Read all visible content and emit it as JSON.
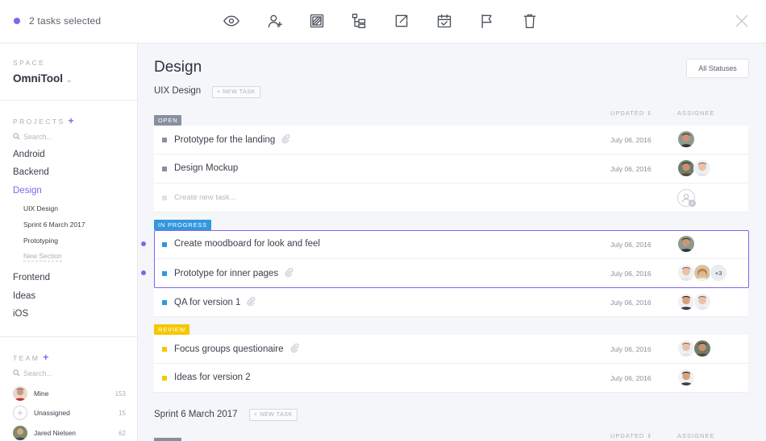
{
  "topbar": {
    "selection_text": "2 tasks selected",
    "icons": [
      "eye-icon",
      "add-assignee-icon",
      "tag-icon",
      "subtask-icon",
      "move-icon",
      "due-date-icon",
      "priority-flag-icon",
      "delete-icon"
    ],
    "close_icon": "close-icon"
  },
  "sidebar": {
    "space_caption": "SPACE",
    "space_name": "OmniTool",
    "projects_caption": "PROJECTS",
    "projects_search_placeholder": "Search...",
    "projects": [
      {
        "label": "Android"
      },
      {
        "label": "Backend"
      },
      {
        "label": "Design",
        "active": true
      },
      {
        "label": "Frontend"
      },
      {
        "label": "Ideas"
      },
      {
        "label": "iOS"
      }
    ],
    "design_lists": [
      {
        "label": "UIX Design"
      },
      {
        "label": "Sprint 6 March 2017"
      },
      {
        "label": "Prototyping"
      },
      {
        "label": "New Section"
      }
    ],
    "team_caption": "TEAM",
    "team_search_placeholder": "Search...",
    "members": [
      {
        "name": "Mine",
        "count": "153"
      },
      {
        "name": "Unassigned",
        "count": "15"
      },
      {
        "name": "Jared Nielsen",
        "count": "62"
      }
    ]
  },
  "main": {
    "title": "Design",
    "status_filter": "All Statuses",
    "new_task_label": "+ NEW TASK",
    "col_updated": "UPDATED",
    "col_assignee": "ASSIGNEE",
    "lists": [
      {
        "name": "UIX Design",
        "groups": [
          {
            "status": "OPEN",
            "color": "#87909e",
            "tasks": [
              {
                "name": "Prototype for the landing",
                "date": "July 06, 2016",
                "attachment": true
              },
              {
                "name": "Design Mockup",
                "date": "July 06, 2016",
                "attachment": false
              }
            ],
            "create_placeholder": "Create new task..."
          },
          {
            "status": "IN PROGRESS",
            "color": "#3397dd",
            "tasks": [
              {
                "name": "Create moodboard for look and feel",
                "date": "July 06, 2016",
                "attachment": false,
                "selected": true
              },
              {
                "name": "Prototype for inner pages",
                "date": "July 06, 2016",
                "attachment": true,
                "selected": true,
                "more_assignees": "+3"
              },
              {
                "name": "QA for version 1",
                "date": "July 06, 2016",
                "attachment": true
              }
            ]
          },
          {
            "status": "REVIEW",
            "color": "#f6c700",
            "tasks": [
              {
                "name": "Focus groups questionaire",
                "date": "July 06, 2016",
                "attachment": true
              },
              {
                "name": "Ideas for version 2",
                "date": "July 06, 2016",
                "attachment": false
              }
            ]
          }
        ]
      },
      {
        "name": "Sprint 6 March 2017"
      }
    ]
  }
}
